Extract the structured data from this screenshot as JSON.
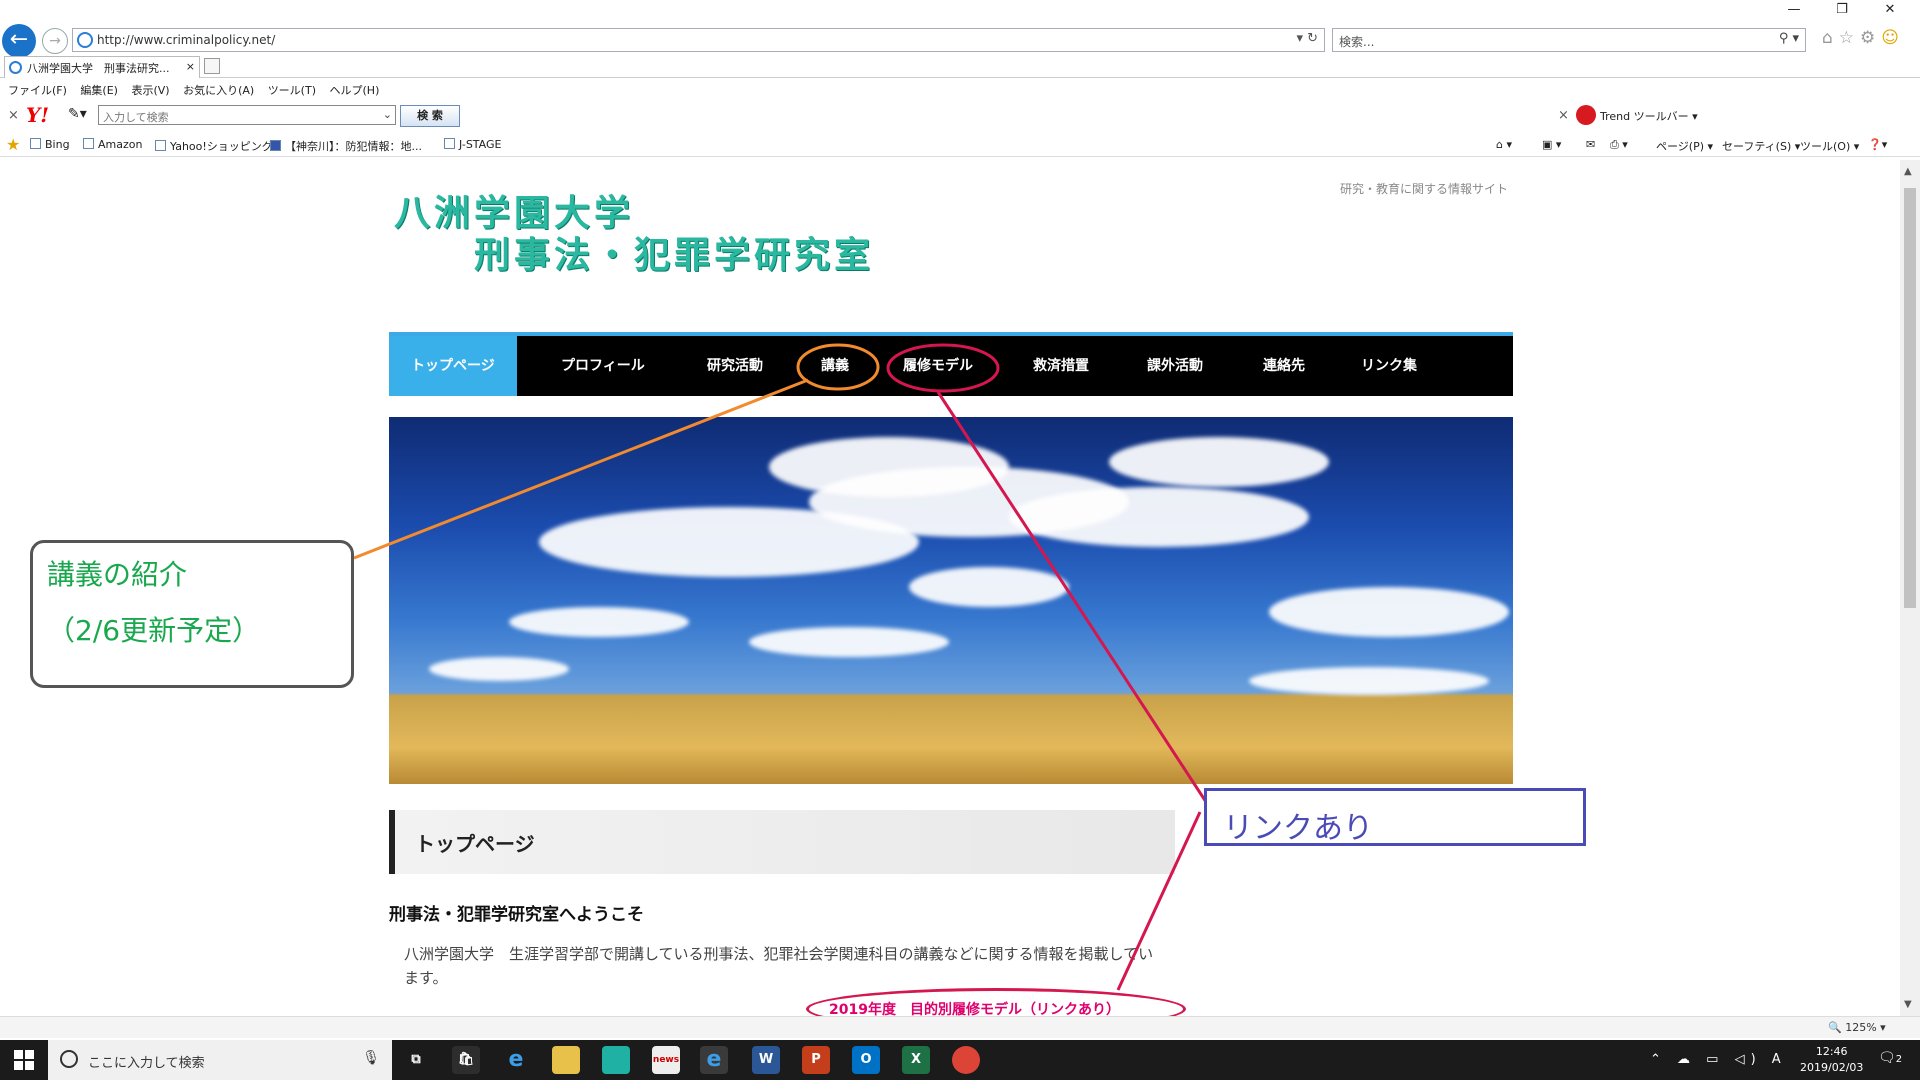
{
  "browser": {
    "url": "http://www.criminalpolicy.net/",
    "search_placeholder": "検索...",
    "tab_title": "八洲学園大学　刑事法研究...",
    "tab_close": "×",
    "menu": [
      "ファイル(F)",
      "編集(E)",
      "表示(V)",
      "お気に入り(A)",
      "ツール(T)",
      "ヘルプ(H)"
    ],
    "yahoo_placeholder": "入力して検索",
    "yahoo_search_button": "検 索",
    "trend_toolbar": "Trend ツールバー ▾",
    "favorites": [
      "Bing",
      "Amazon",
      "Yahoo!ショッピング",
      "【神奈川】：防犯情報：地...",
      "J-STAGE"
    ],
    "commands": [
      "ページ(P) ▾",
      "セーフティ(S) ▾",
      "ツール(O) ▾"
    ],
    "zoom": "🔍 125%  ▾"
  },
  "site": {
    "logo_line1": "八洲学園大学",
    "logo_line2": "刑事法・犯罪学研究室",
    "tagline": "研究・教育に関する情報サイト",
    "nav": [
      "トップページ",
      "プロフィール",
      "研究活動",
      "講義",
      "履修モデル",
      "救済措置",
      "課外活動",
      "連絡先",
      "リンク集"
    ],
    "section_title": "トップページ",
    "welcome": "刑事法・犯罪学研究室へようこそ",
    "intro": "八洲学園大学　生涯学習学部で開講している刑事法、犯罪社会学関連科目の講義などに関する情報を掲載しています。"
  },
  "annotations": {
    "lecture_callout_line1": "講義の紹介",
    "lecture_callout_line2": "（2/6更新予定）",
    "link_callout": "リンクあり",
    "model_label": "2019年度　目的別履修モデル（リンクあり）",
    "colors": {
      "orange": "#f28a2e",
      "red": "#d4174f",
      "green": "#1aa84e",
      "blue": "#4b4bb8"
    }
  },
  "taskbar": {
    "search_placeholder": "ここに入力して検索",
    "time": "12:46",
    "date": "2019/02/03",
    "notifications": "2",
    "ime": "A"
  }
}
